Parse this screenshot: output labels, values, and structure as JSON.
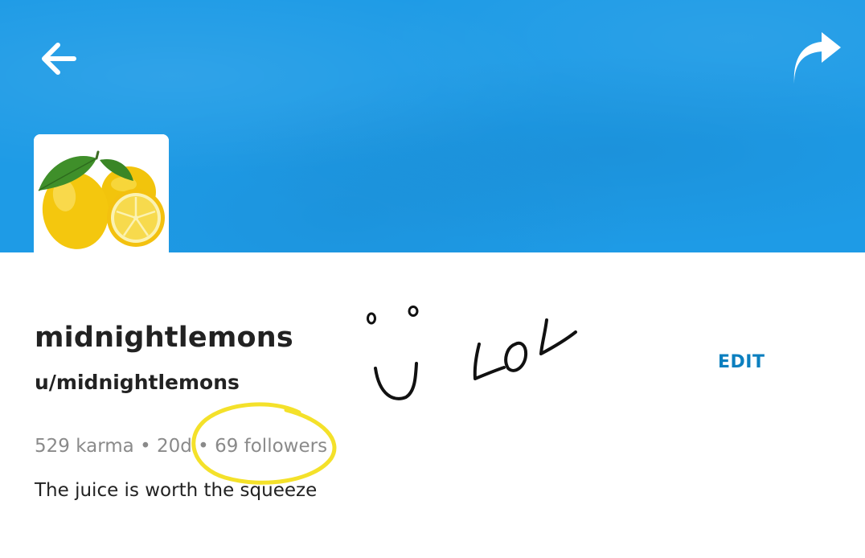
{
  "header": {
    "back_icon": "arrow-left-icon",
    "share_icon": "share-arrow-icon",
    "banner_color": "#1e9be6"
  },
  "profile": {
    "avatar": "lemons-avatar",
    "display_name": "midnightlemons",
    "username": "u/midnightlemons",
    "karma": "529 karma",
    "separator": "•",
    "age": "20d",
    "followers": "69 followers",
    "bio": "The juice is worth the squeeze",
    "edit_label": "EDIT",
    "accent_color": "#0b7fbf"
  },
  "annotation": {
    "handwritten_text": "LOL",
    "highlight_color": "#f4e12a"
  }
}
